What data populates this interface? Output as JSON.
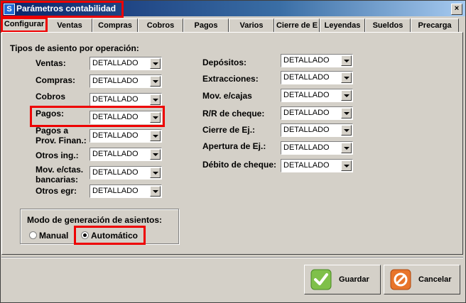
{
  "window": {
    "title": "Parámetros contabilidad",
    "close_label": "×"
  },
  "tabs": [
    "Configurar",
    "Ventas",
    "Compras",
    "Cobros",
    "Pagos",
    "Varios",
    "Cierre de E",
    "Leyendas",
    "Sueldos",
    "Precarga"
  ],
  "section_title": "Tipos de asiento por operación:",
  "left_fields": [
    {
      "label": "Ventas:",
      "value": "DETALLADO"
    },
    {
      "label": "Compras:",
      "value": "DETALLADO"
    },
    {
      "label": "Cobros",
      "value": "DETALLADO"
    },
    {
      "label": "Pagos:",
      "value": "DETALLADO"
    },
    {
      "label": "Pagos a Prov. Finan.:",
      "value": "DETALLADO"
    },
    {
      "label": "Otros ing.:",
      "value": "DETALLADO"
    },
    {
      "label": "Mov. e/ctas. bancarias:",
      "value": "DETALLADO"
    },
    {
      "label": "Otros egr:",
      "value": "DETALLADO"
    }
  ],
  "right_fields": [
    {
      "label": "Depósitos:",
      "value": "DETALLADO"
    },
    {
      "label": "Extracciones:",
      "value": "DETALLADO"
    },
    {
      "label": "Mov. e/cajas",
      "value": "DETALLADO"
    },
    {
      "label": "R/R de cheque:",
      "value": "DETALLADO"
    },
    {
      "label": "Cierre de Ej.:",
      "value": "DETALLADO"
    },
    {
      "label": "Apertura de Ej.:",
      "value": "DETALLADO"
    },
    {
      "label": "Débito de cheque:",
      "value": "DETALLADO"
    }
  ],
  "mode": {
    "title": "Modo de generación de asientos:",
    "options": [
      "Manual",
      "Automático"
    ],
    "selected": "Automático"
  },
  "buttons": {
    "save": "Guardar",
    "cancel": "Cancelar"
  },
  "colors": {
    "highlight": "#e00000",
    "titlebar": "#0a246a",
    "face": "#d4d0c8"
  }
}
